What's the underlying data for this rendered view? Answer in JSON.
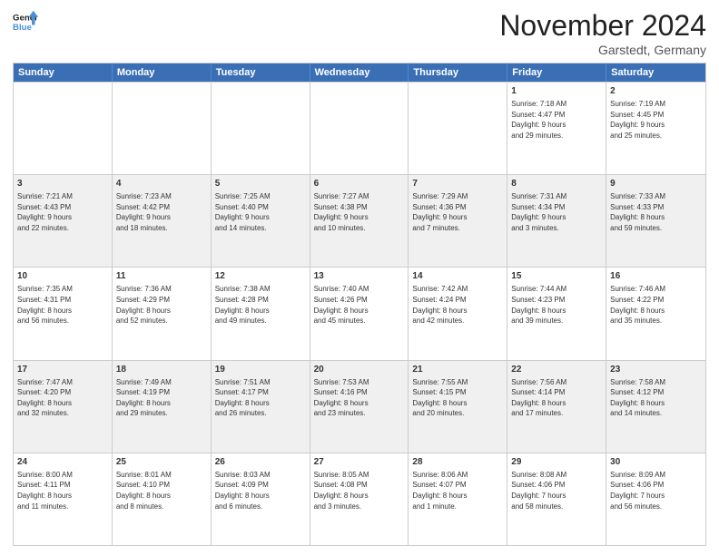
{
  "header": {
    "logo_line1": "General",
    "logo_line2": "Blue",
    "month_title": "November 2024",
    "location": "Garstedt, Germany"
  },
  "weekdays": [
    "Sunday",
    "Monday",
    "Tuesday",
    "Wednesday",
    "Thursday",
    "Friday",
    "Saturday"
  ],
  "rows": [
    [
      {
        "day": "",
        "info": ""
      },
      {
        "day": "",
        "info": ""
      },
      {
        "day": "",
        "info": ""
      },
      {
        "day": "",
        "info": ""
      },
      {
        "day": "",
        "info": ""
      },
      {
        "day": "1",
        "info": "Sunrise: 7:18 AM\nSunset: 4:47 PM\nDaylight: 9 hours\nand 29 minutes."
      },
      {
        "day": "2",
        "info": "Sunrise: 7:19 AM\nSunset: 4:45 PM\nDaylight: 9 hours\nand 25 minutes."
      }
    ],
    [
      {
        "day": "3",
        "info": "Sunrise: 7:21 AM\nSunset: 4:43 PM\nDaylight: 9 hours\nand 22 minutes."
      },
      {
        "day": "4",
        "info": "Sunrise: 7:23 AM\nSunset: 4:42 PM\nDaylight: 9 hours\nand 18 minutes."
      },
      {
        "day": "5",
        "info": "Sunrise: 7:25 AM\nSunset: 4:40 PM\nDaylight: 9 hours\nand 14 minutes."
      },
      {
        "day": "6",
        "info": "Sunrise: 7:27 AM\nSunset: 4:38 PM\nDaylight: 9 hours\nand 10 minutes."
      },
      {
        "day": "7",
        "info": "Sunrise: 7:29 AM\nSunset: 4:36 PM\nDaylight: 9 hours\nand 7 minutes."
      },
      {
        "day": "8",
        "info": "Sunrise: 7:31 AM\nSunset: 4:34 PM\nDaylight: 9 hours\nand 3 minutes."
      },
      {
        "day": "9",
        "info": "Sunrise: 7:33 AM\nSunset: 4:33 PM\nDaylight: 8 hours\nand 59 minutes."
      }
    ],
    [
      {
        "day": "10",
        "info": "Sunrise: 7:35 AM\nSunset: 4:31 PM\nDaylight: 8 hours\nand 56 minutes."
      },
      {
        "day": "11",
        "info": "Sunrise: 7:36 AM\nSunset: 4:29 PM\nDaylight: 8 hours\nand 52 minutes."
      },
      {
        "day": "12",
        "info": "Sunrise: 7:38 AM\nSunset: 4:28 PM\nDaylight: 8 hours\nand 49 minutes."
      },
      {
        "day": "13",
        "info": "Sunrise: 7:40 AM\nSunset: 4:26 PM\nDaylight: 8 hours\nand 45 minutes."
      },
      {
        "day": "14",
        "info": "Sunrise: 7:42 AM\nSunset: 4:24 PM\nDaylight: 8 hours\nand 42 minutes."
      },
      {
        "day": "15",
        "info": "Sunrise: 7:44 AM\nSunset: 4:23 PM\nDaylight: 8 hours\nand 39 minutes."
      },
      {
        "day": "16",
        "info": "Sunrise: 7:46 AM\nSunset: 4:22 PM\nDaylight: 8 hours\nand 35 minutes."
      }
    ],
    [
      {
        "day": "17",
        "info": "Sunrise: 7:47 AM\nSunset: 4:20 PM\nDaylight: 8 hours\nand 32 minutes."
      },
      {
        "day": "18",
        "info": "Sunrise: 7:49 AM\nSunset: 4:19 PM\nDaylight: 8 hours\nand 29 minutes."
      },
      {
        "day": "19",
        "info": "Sunrise: 7:51 AM\nSunset: 4:17 PM\nDaylight: 8 hours\nand 26 minutes."
      },
      {
        "day": "20",
        "info": "Sunrise: 7:53 AM\nSunset: 4:16 PM\nDaylight: 8 hours\nand 23 minutes."
      },
      {
        "day": "21",
        "info": "Sunrise: 7:55 AM\nSunset: 4:15 PM\nDaylight: 8 hours\nand 20 minutes."
      },
      {
        "day": "22",
        "info": "Sunrise: 7:56 AM\nSunset: 4:14 PM\nDaylight: 8 hours\nand 17 minutes."
      },
      {
        "day": "23",
        "info": "Sunrise: 7:58 AM\nSunset: 4:12 PM\nDaylight: 8 hours\nand 14 minutes."
      }
    ],
    [
      {
        "day": "24",
        "info": "Sunrise: 8:00 AM\nSunset: 4:11 PM\nDaylight: 8 hours\nand 11 minutes."
      },
      {
        "day": "25",
        "info": "Sunrise: 8:01 AM\nSunset: 4:10 PM\nDaylight: 8 hours\nand 8 minutes."
      },
      {
        "day": "26",
        "info": "Sunrise: 8:03 AM\nSunset: 4:09 PM\nDaylight: 8 hours\nand 6 minutes."
      },
      {
        "day": "27",
        "info": "Sunrise: 8:05 AM\nSunset: 4:08 PM\nDaylight: 8 hours\nand 3 minutes."
      },
      {
        "day": "28",
        "info": "Sunrise: 8:06 AM\nSunset: 4:07 PM\nDaylight: 8 hours\nand 1 minute."
      },
      {
        "day": "29",
        "info": "Sunrise: 8:08 AM\nSunset: 4:06 PM\nDaylight: 7 hours\nand 58 minutes."
      },
      {
        "day": "30",
        "info": "Sunrise: 8:09 AM\nSunset: 4:06 PM\nDaylight: 7 hours\nand 56 minutes."
      }
    ]
  ]
}
